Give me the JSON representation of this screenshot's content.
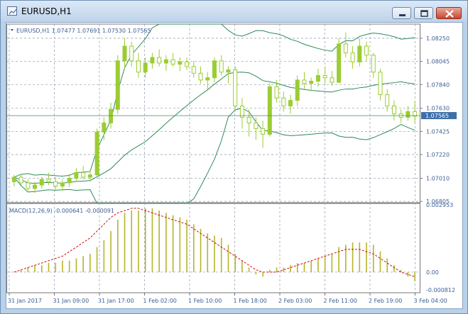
{
  "window": {
    "title": "EURUSD,H1"
  },
  "chart": {
    "info_label": "EURUSD,H1  1.07477 1.07691 1.07530 1.07565",
    "macd_label": "MACD(12,26,9) -0.000641 -0.000091",
    "current_price": "1.07565",
    "price_ticks": [
      "1.08250",
      "1.08045",
      "1.07840",
      "1.07630",
      "1.07425",
      "1.07220",
      "1.07010",
      "1.06805"
    ],
    "macd_ticks": [
      "0.002953",
      "0.00",
      "-0.000812"
    ],
    "time_ticks": [
      "31 Jan 2017",
      "31 Jan 09:00",
      "31 Jan 17:00",
      "1 Feb 02:00",
      "1 Feb 10:00",
      "1 Feb 18:00",
      "2 Feb 03:00",
      "2 Feb 11:00",
      "2 Feb 19:00",
      "3 Feb 04:00"
    ],
    "colors": {
      "candle": "#9acd32",
      "bollinger": "#2e8b57",
      "grid": "#9aa7b8",
      "macd_hist": "#b5b52a",
      "macd_signal": "#d01010",
      "axis_text": "#3c5f95"
    }
  },
  "chart_data": {
    "type": "line",
    "title": "EURUSD,H1",
    "price_range": [
      1.068,
      1.0835
    ],
    "candles": [
      [
        1.0698,
        1.0704,
        1.0694,
        1.0702
      ],
      [
        1.0702,
        1.0705,
        1.0695,
        1.0697
      ],
      [
        1.0697,
        1.07,
        1.069,
        1.0692
      ],
      [
        1.0692,
        1.0698,
        1.0688,
        1.0695
      ],
      [
        1.0695,
        1.0702,
        1.0692,
        1.07
      ],
      [
        1.07,
        1.0706,
        1.0695,
        1.0698
      ],
      [
        1.0698,
        1.0702,
        1.0691,
        1.0694
      ],
      [
        1.0694,
        1.07,
        1.069,
        1.0697
      ],
      [
        1.0697,
        1.0705,
        1.0693,
        1.0701
      ],
      [
        1.0701,
        1.071,
        1.0698,
        1.0706
      ],
      [
        1.0706,
        1.0712,
        1.07,
        1.0702
      ],
      [
        1.0702,
        1.0708,
        1.0698,
        1.0704
      ],
      [
        1.0704,
        1.0745,
        1.0703,
        1.0742
      ],
      [
        1.0742,
        1.0755,
        1.0735,
        1.075
      ],
      [
        1.075,
        1.0768,
        1.0745,
        1.0762
      ],
      [
        1.0762,
        1.081,
        1.0758,
        1.0805
      ],
      [
        1.0805,
        1.0825,
        1.0798,
        1.0818
      ],
      [
        1.0818,
        1.0822,
        1.08,
        1.0805
      ],
      [
        1.0805,
        1.0812,
        1.079,
        1.0795
      ],
      [
        1.0795,
        1.0808,
        1.079,
        1.0803
      ],
      [
        1.0803,
        1.0812,
        1.0798,
        1.0808
      ],
      [
        1.0808,
        1.0815,
        1.08,
        1.0803
      ],
      [
        1.0803,
        1.081,
        1.0796,
        1.0806
      ],
      [
        1.0806,
        1.0812,
        1.08,
        1.0802
      ],
      [
        1.0802,
        1.0808,
        1.0796,
        1.0804
      ],
      [
        1.0804,
        1.0808,
        1.0797,
        1.08
      ],
      [
        1.08,
        1.0805,
        1.079,
        1.0794
      ],
      [
        1.0794,
        1.08,
        1.0785,
        1.0788
      ],
      [
        1.0788,
        1.0795,
        1.078,
        1.079
      ],
      [
        1.079,
        1.0808,
        1.0786,
        1.0805
      ],
      [
        1.0805,
        1.081,
        1.0792,
        1.0795
      ],
      [
        1.0795,
        1.08,
        1.0785,
        1.0797
      ],
      [
        1.0797,
        1.08,
        1.076,
        1.0765
      ],
      [
        1.0765,
        1.0772,
        1.0745,
        1.0755
      ],
      [
        1.0755,
        1.0762,
        1.0738,
        1.075
      ],
      [
        1.075,
        1.0755,
        1.0735,
        1.0745
      ],
      [
        1.0745,
        1.0752,
        1.0728,
        1.074
      ],
      [
        1.074,
        1.0785,
        1.0738,
        1.0782
      ],
      [
        1.0782,
        1.0788,
        1.0768,
        1.0772
      ],
      [
        1.0772,
        1.0778,
        1.076,
        1.0765
      ],
      [
        1.0765,
        1.0775,
        1.0758,
        1.077
      ],
      [
        1.077,
        1.0792,
        1.0765,
        1.0788
      ],
      [
        1.0788,
        1.0795,
        1.078,
        1.0785
      ],
      [
        1.0785,
        1.079,
        1.0778,
        1.0787
      ],
      [
        1.0787,
        1.0798,
        1.0782,
        1.0792
      ],
      [
        1.0792,
        1.08,
        1.0785,
        1.079
      ],
      [
        1.079,
        1.0796,
        1.0783,
        1.0786
      ],
      [
        1.0786,
        1.0825,
        1.0785,
        1.082
      ],
      [
        1.082,
        1.083,
        1.0808,
        1.0812
      ],
      [
        1.0812,
        1.0818,
        1.0798,
        1.0804
      ],
      [
        1.0804,
        1.0825,
        1.08,
        1.0818
      ],
      [
        1.0818,
        1.0822,
        1.0805,
        1.081
      ],
      [
        1.081,
        1.0812,
        1.079,
        1.0795
      ],
      [
        1.0795,
        1.0798,
        1.077,
        1.0775
      ],
      [
        1.0775,
        1.078,
        1.076,
        1.0765
      ],
      [
        1.0765,
        1.077,
        1.0752,
        1.0758
      ],
      [
        1.0758,
        1.0762,
        1.075,
        1.0755
      ],
      [
        1.0755,
        1.0765,
        1.0752,
        1.076
      ],
      [
        1.076,
        1.0769,
        1.075,
        1.0756
      ]
    ],
    "macd_range": [
      -0.000812,
      0.002953
    ],
    "macd_hist": [
      0.0,
      0.0001,
      0.0002,
      0.0003,
      0.0003,
      0.0004,
      0.0004,
      0.0005,
      0.0005,
      0.0006,
      0.0007,
      0.0008,
      0.0011,
      0.0014,
      0.0018,
      0.0023,
      0.0026,
      0.0027,
      0.0027,
      0.0028,
      0.0028,
      0.0027,
      0.0026,
      0.0025,
      0.0024,
      0.0023,
      0.0021,
      0.0019,
      0.0017,
      0.0016,
      0.0015,
      0.0012,
      0.0008,
      0.0005,
      0.0002,
      -0.0001,
      -0.0002,
      0.0001,
      0.0002,
      0.0002,
      0.0003,
      0.0004,
      0.0004,
      0.0005,
      0.0006,
      0.0007,
      0.0008,
      0.0011,
      0.0012,
      0.0013,
      0.0013,
      0.0013,
      0.0012,
      0.0009,
      0.0006,
      0.0003,
      0.0001,
      -0.0002,
      -0.0004
    ],
    "macd_signal": [
      0.0,
      0.0001,
      0.0002,
      0.0003,
      0.0004,
      0.0005,
      0.0006,
      0.0007,
      0.0009,
      0.0011,
      0.0013,
      0.0015,
      0.0018,
      0.0021,
      0.0024,
      0.0026,
      0.0027,
      0.0028,
      0.0028,
      0.0027,
      0.0026,
      0.0025,
      0.0024,
      0.0023,
      0.0022,
      0.0021,
      0.0019,
      0.0017,
      0.0015,
      0.0013,
      0.0011,
      0.0009,
      0.0007,
      0.0005,
      0.0003,
      0.0001,
      0.0,
      0.0,
      0.0,
      0.0001,
      0.0002,
      0.0003,
      0.0004,
      0.0005,
      0.0006,
      0.0007,
      0.0008,
      0.0009,
      0.001,
      0.001,
      0.001,
      0.0009,
      0.0008,
      0.0006,
      0.0004,
      0.0002,
      0.0,
      -0.0001,
      -0.0002
    ]
  }
}
